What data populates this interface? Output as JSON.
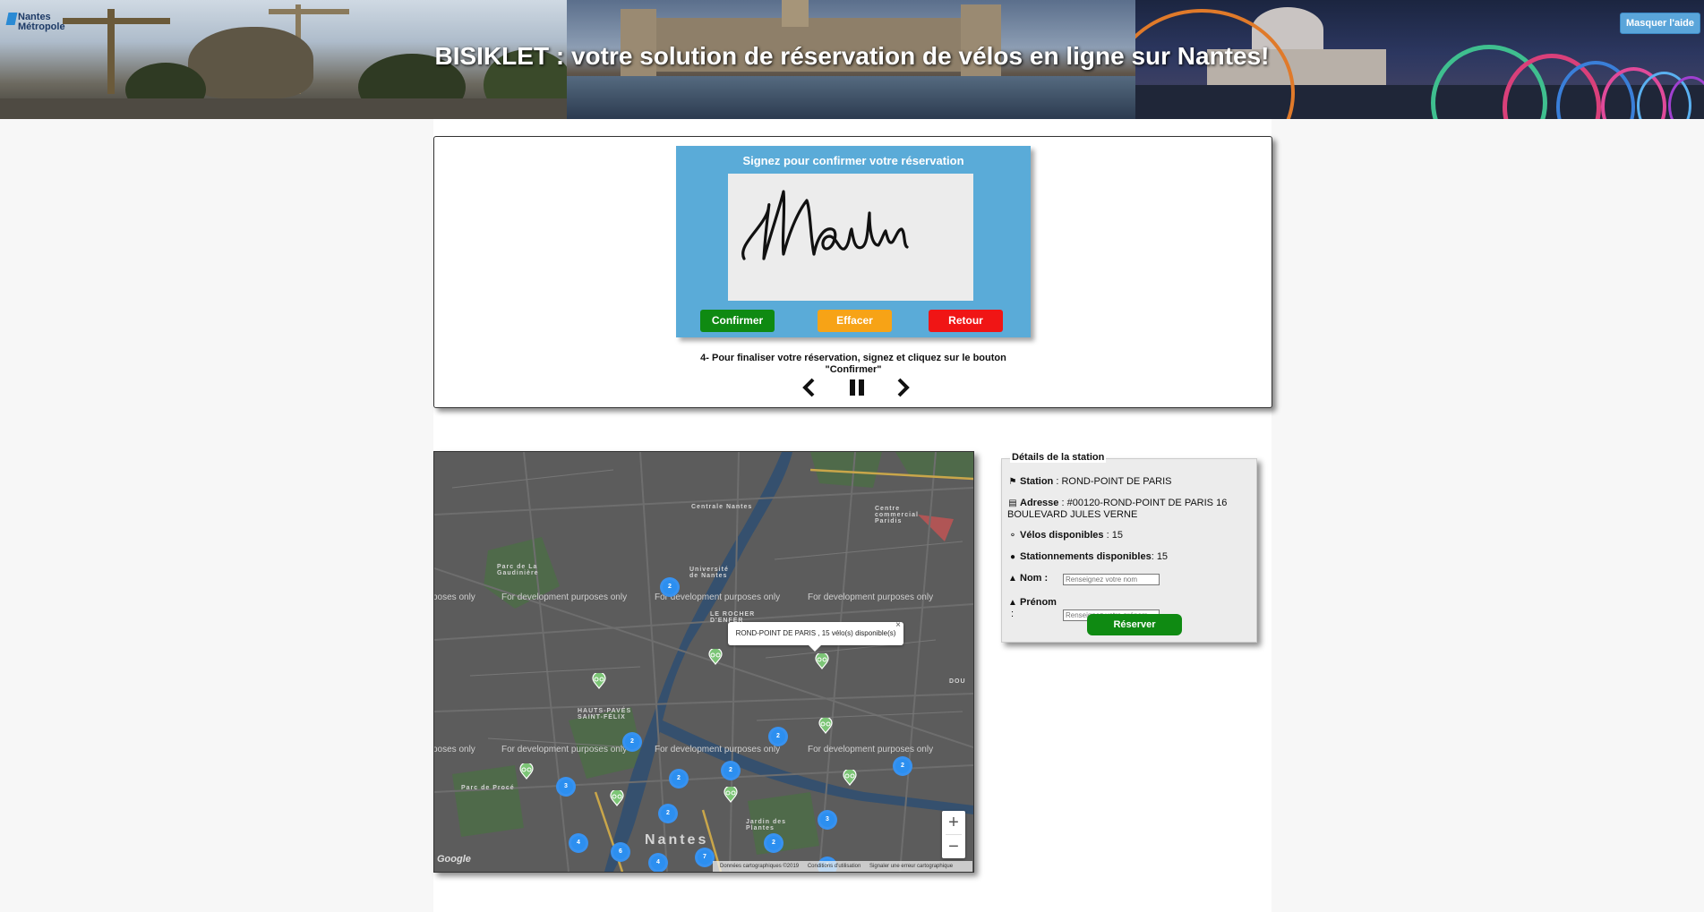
{
  "header": {
    "title": "BISIKLET : votre solution de réservation de vélos en ligne sur Nantes!",
    "logo_text_line1": "Nantes",
    "logo_text_line2": "Métropole",
    "help_button": "Masquer l'aide"
  },
  "signature": {
    "title": "Signez pour confirmer votre réservation",
    "signature_text": "Moutin",
    "confirm_label": "Confirmer",
    "clear_label": "Effacer",
    "back_label": "Retour"
  },
  "slideshow": {
    "instruction_line1": "4- Pour finaliser votre réservation, signez et cliquez sur le bouton",
    "instruction_line2": "\"Confirmer\""
  },
  "map": {
    "dev_text": "For development purposes only",
    "dev_text_partial": "poses only",
    "labels": {
      "centrale": "Centrale Nantes",
      "parc_gaudiniere": "Parc de La Gaudinière",
      "universite": "Université de Nantes",
      "rocher": "LE ROCHER D'ENFER",
      "hauts_paves": "HAUTS-PAVÉS SAINT-FÉLIX",
      "parc_procé": "Parc de Procé",
      "nantes": "Nantes",
      "jardin": "Jardin des Plantes",
      "centre_commercial": "Centre commercial Paridis",
      "doulon": "DOU"
    },
    "cluster_counts": [
      "2",
      "2",
      "2",
      "2",
      "2",
      "2",
      "3",
      "2",
      "3",
      "4",
      "2",
      "6",
      "7",
      "4",
      "2"
    ],
    "infowindow": {
      "text": "ROND-POINT DE PARIS , 15 vélo(s) disponible(s)",
      "close": "×"
    },
    "zoom_in": "+",
    "zoom_out": "−",
    "google_logo": "Google",
    "attribution": {
      "data": "Données cartographiques ©2019",
      "terms": "Conditions d'utilisation",
      "report": "Signaler une erreur cartographique"
    },
    "colors": {
      "cluster": "#2c8ff0",
      "marker": "#7cc576",
      "river": "#35506e"
    }
  },
  "details": {
    "legend": "Détails de la station",
    "station_label": "Station",
    "station_value": "ROND-POINT DE PARIS",
    "address_label": "Adresse",
    "address_value": "#00120-ROND-POINT DE PARIS 16",
    "address_value2": "BOULEVARD JULES VERNE",
    "bikes_label": "Vélos disponibles",
    "bikes_value": "15",
    "stands_label": "Stationnements disponibles",
    "stands_value": "15",
    "nom_label": "Nom :",
    "nom_placeholder": "Renseignez votre nom",
    "prenom_label": "Prénom",
    "prenom_colon": ":",
    "prenom_placeholder": "Renseignez votre prénom",
    "reserve_label": "Réserver"
  }
}
